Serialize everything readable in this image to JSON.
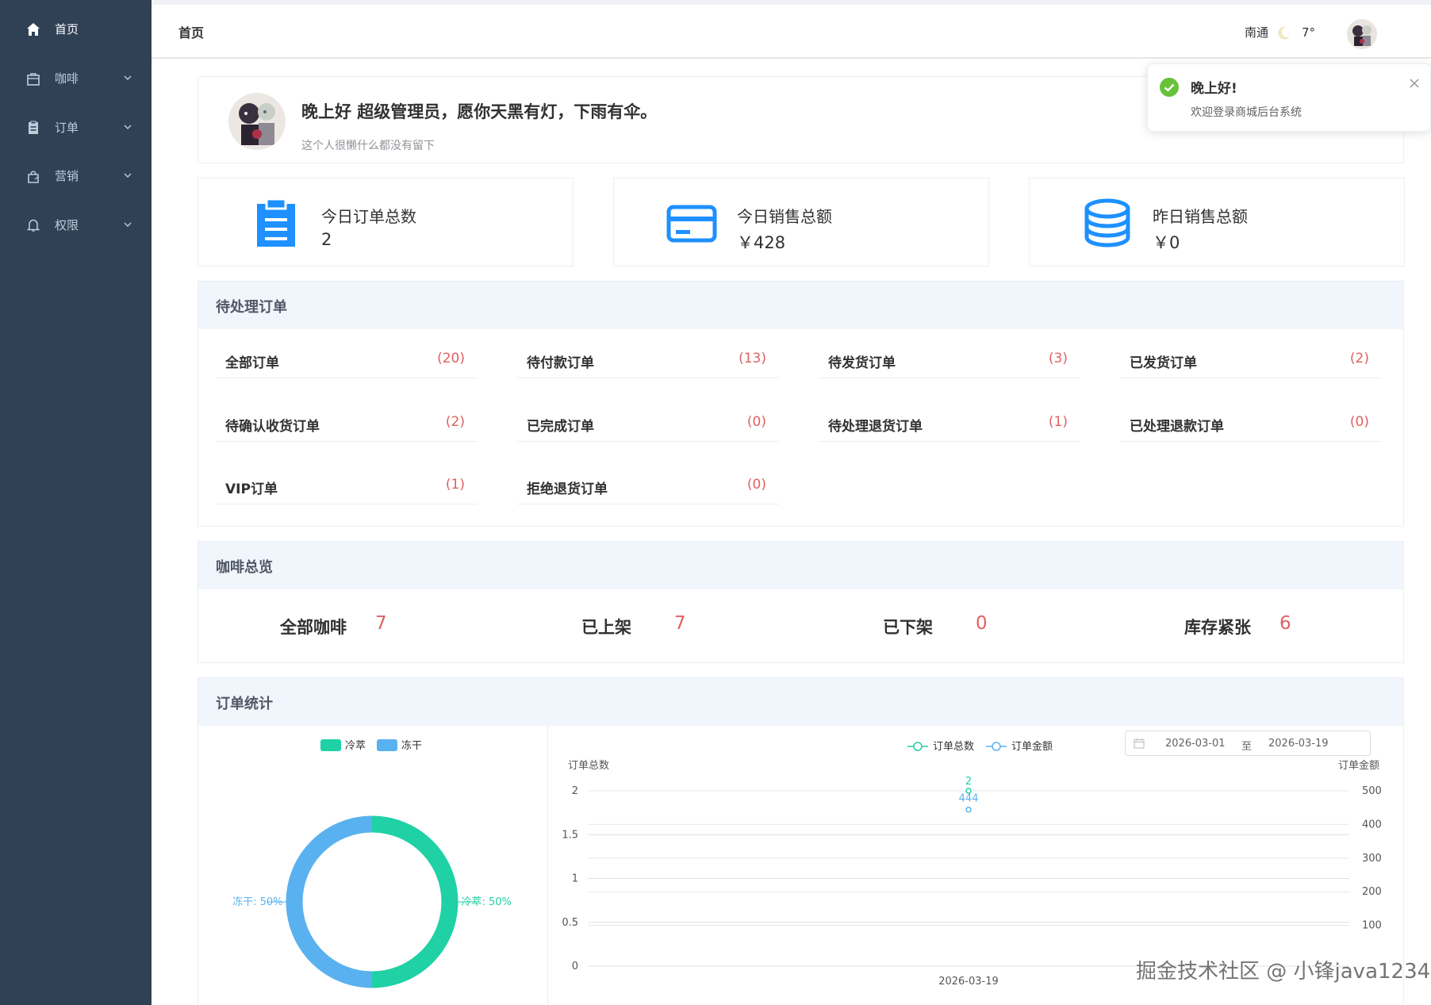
{
  "sidebar": {
    "items": [
      {
        "label": "首页",
        "icon": "home-icon",
        "has_submenu": false
      },
      {
        "label": "咖啡",
        "icon": "shopping-bag-icon",
        "has_submenu": true
      },
      {
        "label": "订单",
        "icon": "clipboard-icon",
        "has_submenu": true
      },
      {
        "label": "营销",
        "icon": "promotion-icon",
        "has_submenu": true
      },
      {
        "label": "权限",
        "icon": "bell-icon",
        "has_submenu": true
      }
    ]
  },
  "header": {
    "breadcrumb": "首页",
    "city": "南通",
    "weather_icon": "moon-icon",
    "temperature": "7°"
  },
  "notification": {
    "title": "晚上好!",
    "message": "欢迎登录商城后台系统"
  },
  "welcome": {
    "greeting": "晚上好 超级管理员，愿你天黑有灯，下雨有伞。",
    "signature": "这个人很懒什么都没有留下"
  },
  "stats_cards": [
    {
      "title": "今日订单总数",
      "value": "2",
      "icon": "clipboard-icon",
      "color": "#1e90ff"
    },
    {
      "title": "今日销售总额",
      "value": "￥428",
      "icon": "credit-card-icon",
      "color": "#1e90ff"
    },
    {
      "title": "昨日销售总额",
      "value": "￥0",
      "icon": "coins-stack-icon",
      "color": "#1e90ff"
    }
  ],
  "pending_orders": {
    "title": "待处理订单",
    "items": [
      {
        "label": "全部订单",
        "count": "(20)"
      },
      {
        "label": "待付款订单",
        "count": "(13)"
      },
      {
        "label": "待发货订单",
        "count": "(3)"
      },
      {
        "label": "已发货订单",
        "count": "(2)"
      },
      {
        "label": "待确认收货订单",
        "count": "(2)"
      },
      {
        "label": "已完成订单",
        "count": "(0)"
      },
      {
        "label": "待处理退货订单",
        "count": "(1)"
      },
      {
        "label": "已处理退款订单",
        "count": "(0)"
      },
      {
        "label": "VIP订单",
        "count": "(1)"
      },
      {
        "label": "拒绝退货订单",
        "count": "(0)"
      }
    ]
  },
  "coffee_overview": {
    "title": "咖啡总览",
    "items": [
      {
        "label": "全部咖啡",
        "value": "7"
      },
      {
        "label": "已上架",
        "value": "7"
      },
      {
        "label": "已下架",
        "value": "0"
      },
      {
        "label": "库存紧张",
        "value": "6"
      }
    ]
  },
  "order_stats": {
    "title": "订单统计",
    "date_start": "2026-03-01",
    "date_separator": "至",
    "date_end": "2026-03-19"
  },
  "colors": {
    "sidebar_bg": "#304156",
    "accent_blue": "#1e90ff",
    "count_red": "#e06060",
    "teal": "#1fd1a4",
    "light_blue": "#5ab1ef"
  },
  "chart_data": [
    {
      "type": "pie",
      "labels": [
        "冷萃",
        "冻干"
      ],
      "values": [
        50,
        50
      ],
      "colors": [
        "#1fd1a4",
        "#5ab1ef"
      ],
      "data_labels": [
        "冷萃: 50%",
        "冻干: 50%"
      ],
      "legend": "top-center",
      "donut": true
    },
    {
      "type": "line",
      "categories": [
        "2026-03-19"
      ],
      "series": [
        {
          "name": "订单总数",
          "values": [
            2
          ],
          "axis": "left",
          "color": "#1fd1a4"
        },
        {
          "name": "订单金额",
          "values": [
            444
          ],
          "axis": "right",
          "color": "#5ab1ef"
        }
      ],
      "ylabel_left": "订单总数",
      "ylabel_right": "订单金额",
      "ylim_left": [
        0,
        2
      ],
      "yticks_left": [
        "0",
        "0.5",
        "1",
        "1.5",
        "2"
      ],
      "ylim_right": [
        0,
        500
      ],
      "yticks_right": [
        "100",
        "200",
        "300",
        "400",
        "500"
      ],
      "legend": "top-center",
      "grid": true
    }
  ],
  "watermark": "掘金技术社区 @ 小锋java1234"
}
